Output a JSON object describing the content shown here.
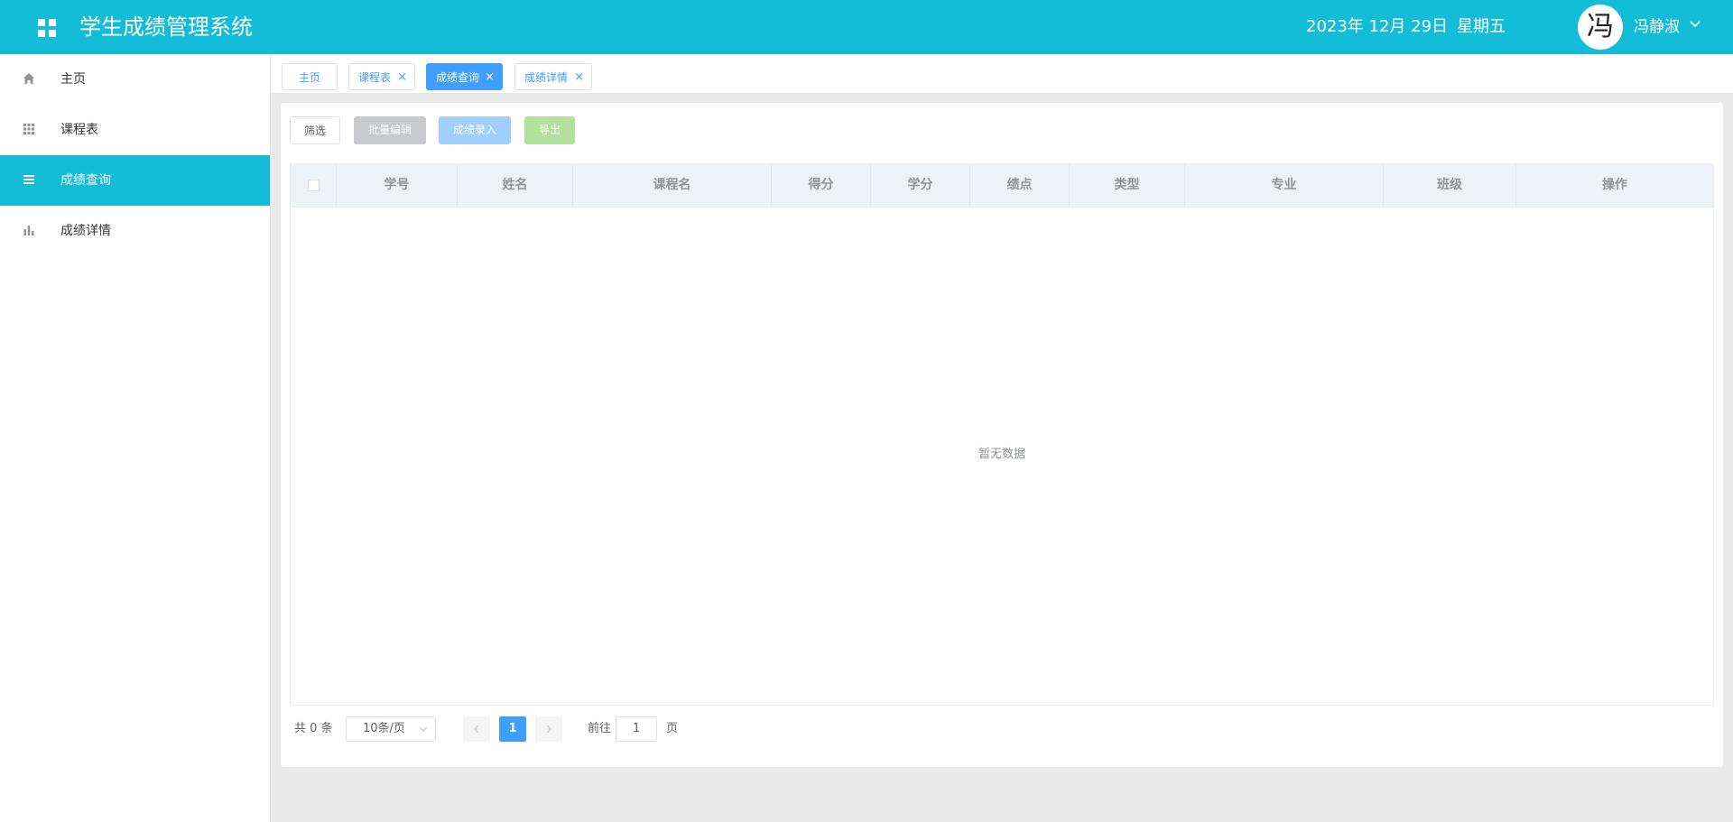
{
  "header": {
    "title": "学生成绩管理系统",
    "date": "2023年 12月 29日",
    "weekday": "星期五",
    "avatar_char": "冯",
    "username": "冯静淑"
  },
  "sidebar": {
    "items": [
      {
        "label": "主页",
        "icon": "home-icon"
      },
      {
        "label": "课程表",
        "icon": "grid-icon"
      },
      {
        "label": "成绩查询",
        "icon": "list-icon",
        "active": true
      },
      {
        "label": "成绩详情",
        "icon": "bar-chart-icon"
      }
    ]
  },
  "tabs": [
    {
      "label": "主页",
      "closable": false
    },
    {
      "label": "课程表",
      "closable": true,
      "close": "×"
    },
    {
      "label": "成绩查询",
      "closable": true,
      "close": "×",
      "active": true
    },
    {
      "label": "成绩详情",
      "closable": true,
      "close": "×"
    }
  ],
  "toolbar": {
    "filter": "筛选",
    "batch_edit": "批量编辑",
    "grade_entry": "成绩录入",
    "export": "导出"
  },
  "table": {
    "columns": [
      "学号",
      "姓名",
      "课程名",
      "得分",
      "学分",
      "绩点",
      "类型",
      "专业",
      "班级",
      "操作"
    ],
    "empty_text": "暂无数据"
  },
  "pagination": {
    "total": "共 0 条",
    "page_size": "10条/页",
    "current_page": "1",
    "goto_label": "前往",
    "goto_value": "1",
    "goto_unit": "页"
  },
  "colors": {
    "header": "#14bdd7",
    "primary": "#409eff",
    "disabled_gray": "#c8c9cc",
    "disabled_blue": "#a0cfff",
    "disabled_green": "#b3e19d"
  }
}
